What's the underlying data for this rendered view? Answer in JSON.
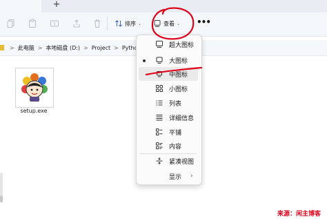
{
  "toolbar": {
    "sort_label": "排序",
    "view_label": "查看",
    "more_label": "•••"
  },
  "breadcrumb": {
    "items": [
      "此电脑",
      "本地磁盘 (D:)",
      "Project",
      "Python"
    ],
    "separator": ">"
  },
  "file": {
    "name": "setup.exe"
  },
  "view_menu": {
    "items": [
      {
        "label": "超大图标",
        "icon": "monitor-icon"
      },
      {
        "label": "大图标",
        "icon": "monitor-icon",
        "selected": true
      },
      {
        "label": "中图标",
        "icon": "monitor-icon",
        "hovered": true
      },
      {
        "label": "小图标",
        "icon": "grid-icon"
      },
      {
        "label": "列表",
        "icon": "list-icon"
      },
      {
        "label": "详细信息",
        "icon": "details-icon"
      },
      {
        "label": "平铺",
        "icon": "tiles-icon"
      },
      {
        "label": "内容",
        "icon": "content-icon"
      },
      {
        "label": "紧凑视图",
        "icon": "compact-icon"
      },
      {
        "label": "显示",
        "icon": "none",
        "submenu": true
      }
    ]
  },
  "watermark": "来源：闲主博客",
  "colors": {
    "annotation": "#e0001a",
    "menu_bg": "#fbfbfb",
    "toolbar_bg": "#f5f8fb",
    "hover_bg": "#eaeaea"
  }
}
